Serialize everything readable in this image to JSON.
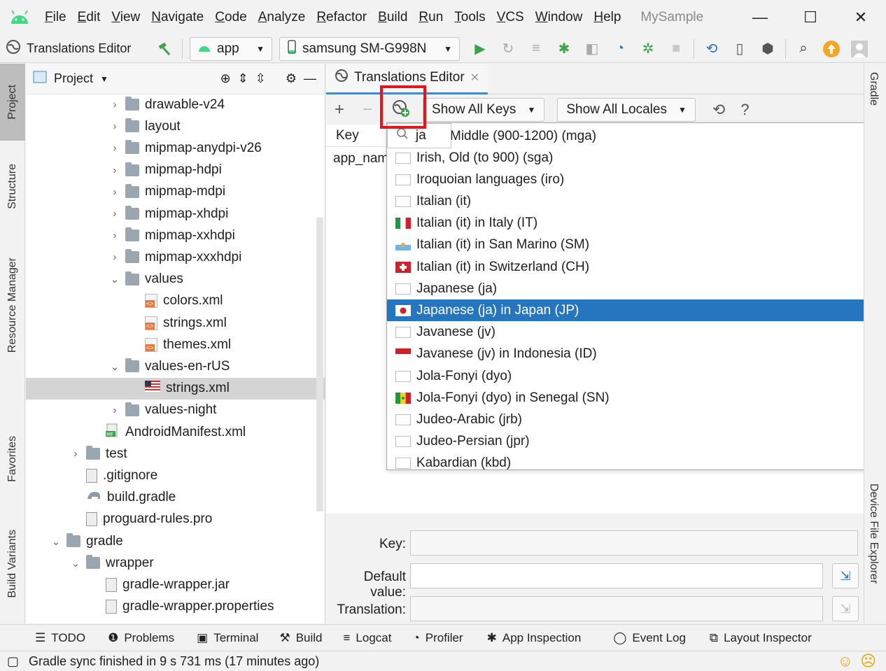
{
  "menubar": {
    "items": [
      "File",
      "Edit",
      "View",
      "Navigate",
      "Code",
      "Analyze",
      "Refactor",
      "Build",
      "Run",
      "Tools",
      "VCS",
      "Window",
      "Help"
    ],
    "project_name": "MySample"
  },
  "toolbar": {
    "breadcrumb": "Translations Editor",
    "module": "app",
    "device": "samsung SM-G998N"
  },
  "left_tabs": [
    "Project",
    "Structure",
    "Resource Manager",
    "Favorites",
    "Build Variants"
  ],
  "project_panel": {
    "title": "Project",
    "tree": [
      {
        "label": "drawable-v24",
        "depth": 3,
        "type": "folder",
        "expanded": false
      },
      {
        "label": "layout",
        "depth": 3,
        "type": "folder",
        "expanded": false
      },
      {
        "label": "mipmap-anydpi-v26",
        "depth": 3,
        "type": "folder",
        "expanded": false
      },
      {
        "label": "mipmap-hdpi",
        "depth": 3,
        "type": "folder",
        "expanded": false
      },
      {
        "label": "mipmap-mdpi",
        "depth": 3,
        "type": "folder",
        "expanded": false
      },
      {
        "label": "mipmap-xhdpi",
        "depth": 3,
        "type": "folder",
        "expanded": false
      },
      {
        "label": "mipmap-xxhdpi",
        "depth": 3,
        "type": "folder",
        "expanded": false
      },
      {
        "label": "mipmap-xxxhdpi",
        "depth": 3,
        "type": "folder",
        "expanded": false
      },
      {
        "label": "values",
        "depth": 3,
        "type": "folder",
        "expanded": true
      },
      {
        "label": "colors.xml",
        "depth": 4,
        "type": "xml"
      },
      {
        "label": "strings.xml",
        "depth": 4,
        "type": "xml"
      },
      {
        "label": "themes.xml",
        "depth": 4,
        "type": "xml"
      },
      {
        "label": "values-en-rUS",
        "depth": 3,
        "type": "folder",
        "expanded": true
      },
      {
        "label": "strings.xml",
        "depth": 4,
        "type": "xml-us",
        "selected": true
      },
      {
        "label": "values-night",
        "depth": 3,
        "type": "folder",
        "expanded": false
      },
      {
        "label": "AndroidManifest.xml",
        "depth": 2,
        "type": "manifest"
      },
      {
        "label": "test",
        "depth": 1,
        "type": "folder",
        "expanded": false
      },
      {
        "label": ".gitignore",
        "depth": 1,
        "type": "file"
      },
      {
        "label": "build.gradle",
        "depth": 1,
        "type": "gradle"
      },
      {
        "label": "proguard-rules.pro",
        "depth": 1,
        "type": "file"
      },
      {
        "label": "gradle",
        "depth": 0,
        "type": "folder",
        "expanded": true
      },
      {
        "label": "wrapper",
        "depth": 1,
        "type": "folder",
        "expanded": true
      },
      {
        "label": "gradle-wrapper.jar",
        "depth": 2,
        "type": "file"
      },
      {
        "label": "gradle-wrapper.properties",
        "depth": 2,
        "type": "file"
      }
    ]
  },
  "editor": {
    "tab_title": "Translations Editor",
    "show_keys": "Show All Keys",
    "show_locales": "Show All Locales",
    "table_header_key": "Key",
    "first_row_key": "app_nam"
  },
  "locale_popup": {
    "search_value": "ja",
    "first_item_partial": "Middle (900-1200) (mga)",
    "items": [
      {
        "label": "Irish, Old (to 900) (sga)",
        "flag": "none"
      },
      {
        "label": "Iroquoian languages (iro)",
        "flag": "none"
      },
      {
        "label": "Italian (it)",
        "flag": "none"
      },
      {
        "label": "Italian (it) in Italy (IT)",
        "flag": "it"
      },
      {
        "label": "Italian (it) in San Marino (SM)",
        "flag": "sm"
      },
      {
        "label": "Italian (it) in Switzerland (CH)",
        "flag": "ch"
      },
      {
        "label": "Japanese (ja)",
        "flag": "none"
      },
      {
        "label": "Japanese (ja) in Japan (JP)",
        "flag": "jp",
        "selected": true
      },
      {
        "label": "Javanese (jv)",
        "flag": "none"
      },
      {
        "label": "Javanese (jv) in Indonesia (ID)",
        "flag": "id"
      },
      {
        "label": "Jola-Fonyi (dyo)",
        "flag": "none"
      },
      {
        "label": "Jola-Fonyi (dyo) in Senegal (SN)",
        "flag": "sn"
      },
      {
        "label": "Judeo-Arabic (jrb)",
        "flag": "none"
      },
      {
        "label": "Judeo-Persian (jpr)",
        "flag": "none"
      },
      {
        "label": "Kabardian (kbd)",
        "flag": "none"
      }
    ]
  },
  "fields": {
    "key_label": "Key:",
    "default_label": "Default value:",
    "translation_label": "Translation:"
  },
  "right_tabs": {
    "top": "Gradle",
    "bottom": "Device File Explorer"
  },
  "tool_tabs": [
    "TODO",
    "Problems",
    "Terminal",
    "Build",
    "Logcat",
    "Profiler",
    "App Inspection",
    "Event Log",
    "Layout Inspector"
  ],
  "status": {
    "message": "Gradle sync finished in 9 s 731 ms (17 minutes ago)"
  },
  "colors": {
    "accent": "#2675bf",
    "android_green": "#3ddc84",
    "highlight_red": "#e8141c",
    "run_green": "#3aa547"
  }
}
